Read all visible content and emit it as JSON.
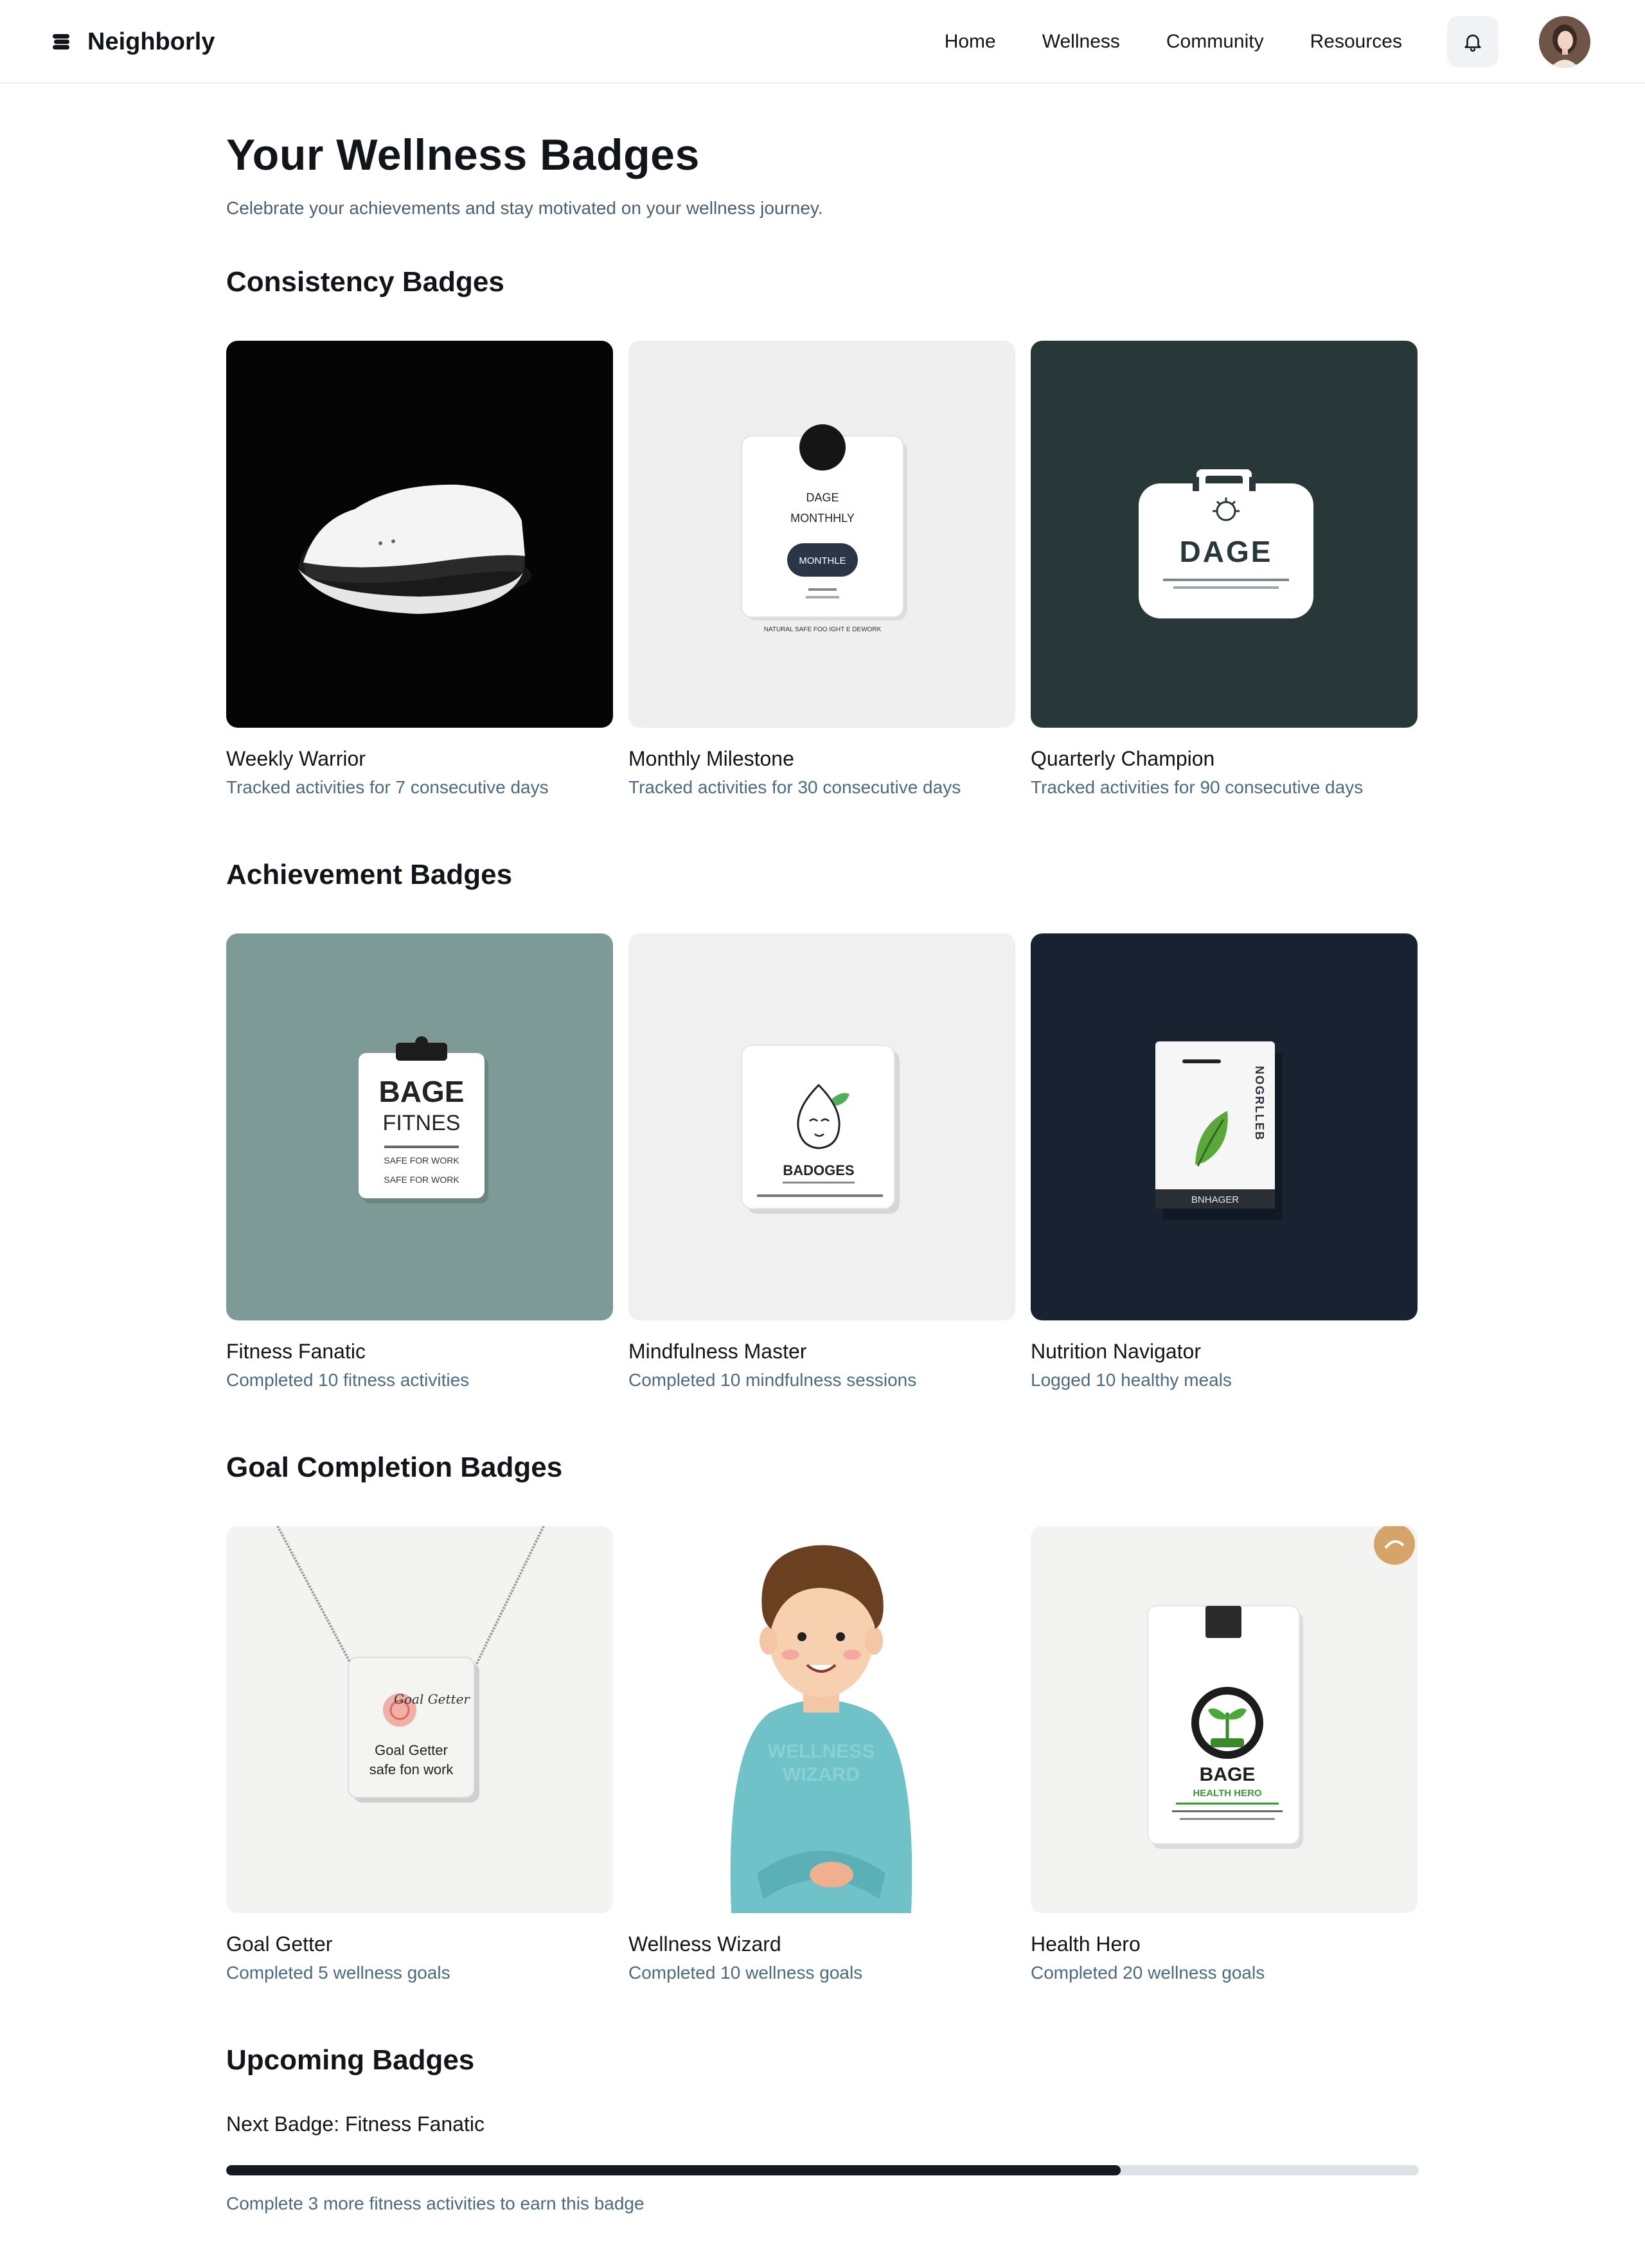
{
  "header": {
    "brand": "Neighborly",
    "nav": [
      "Home",
      "Wellness",
      "Community",
      "Resources"
    ]
  },
  "page": {
    "title": "Your Wellness Badges",
    "subtitle": "Celebrate your achievements and stay motivated on your wellness journey."
  },
  "sections": [
    {
      "title": "Consistency Badges",
      "badges": [
        {
          "title": "Weekly Warrior",
          "desc": "Tracked activities for 7 consecutive days",
          "bg": "#050505",
          "icon": "white-device-icon"
        },
        {
          "title": "Monthly Milestone",
          "desc": "Tracked activities for 30 consecutive days",
          "bg": "#efefef",
          "icon": "badge-tag-icon",
          "img_text": [
            "DAGE",
            "MONTHHLY",
            "MONTHLE",
            "NATURAL SAFE FOO IGHT E DEWORK"
          ]
        },
        {
          "title": "Quarterly Champion",
          "desc": "Tracked activities for 90 consecutive days",
          "bg": "#283838",
          "icon": "briefcase-badge-icon",
          "img_text": [
            "DAGE"
          ]
        }
      ]
    },
    {
      "title": "Achievement Badges",
      "badges": [
        {
          "title": "Fitness Fanatic",
          "desc": "Completed 10 fitness activities",
          "bg": "#7e9a96",
          "icon": "clipboard-badge-icon",
          "img_text": [
            "BAGE",
            "FITNES",
            "SAFE FOR WORK",
            "SAFE FOR WORK"
          ]
        },
        {
          "title": "Mindfulness Master",
          "desc": "Completed 10 mindfulness sessions",
          "bg": "#f0f0f0",
          "icon": "mindful-badge-icon",
          "img_text": [
            "BADOGES"
          ]
        },
        {
          "title": "Nutrition Navigator",
          "desc": "Logged 10 healthy meals",
          "bg": "#182230",
          "icon": "leaf-badge-icon",
          "img_text": [
            "NOGRLLEB",
            "BNHAGER"
          ]
        }
      ]
    },
    {
      "title": "Goal Completion Badges",
      "badges": [
        {
          "title": "Goal Getter",
          "desc": "Completed 5 wellness goals",
          "bg": "#f3f3f2",
          "icon": "necklace-badge-icon",
          "img_text": [
            "Goal Getter",
            "safe fon work",
            "Goal Getter"
          ]
        },
        {
          "title": "Wellness Wizard",
          "desc": "Completed 10 wellness goals",
          "bg": "#ffffff",
          "icon": "person-illustration-icon",
          "img_text": [
            "WELLNESS",
            "WIZARD"
          ]
        },
        {
          "title": "Health Hero",
          "desc": "Completed 20 wellness goals",
          "bg": "#f3f3f2",
          "icon": "plant-badge-icon",
          "img_text": [
            "BAGE",
            "HEALTH HERO"
          ]
        }
      ]
    }
  ],
  "upcoming": {
    "title": "Upcoming Badges",
    "label": "Next Badge: Fitness Fanatic",
    "progress": 0.75,
    "note": "Complete 3 more fitness activities to earn this badge"
  },
  "colors": {
    "accent": "#141a20",
    "muted_text": "#4a6a80",
    "track": "#dde2e6"
  }
}
